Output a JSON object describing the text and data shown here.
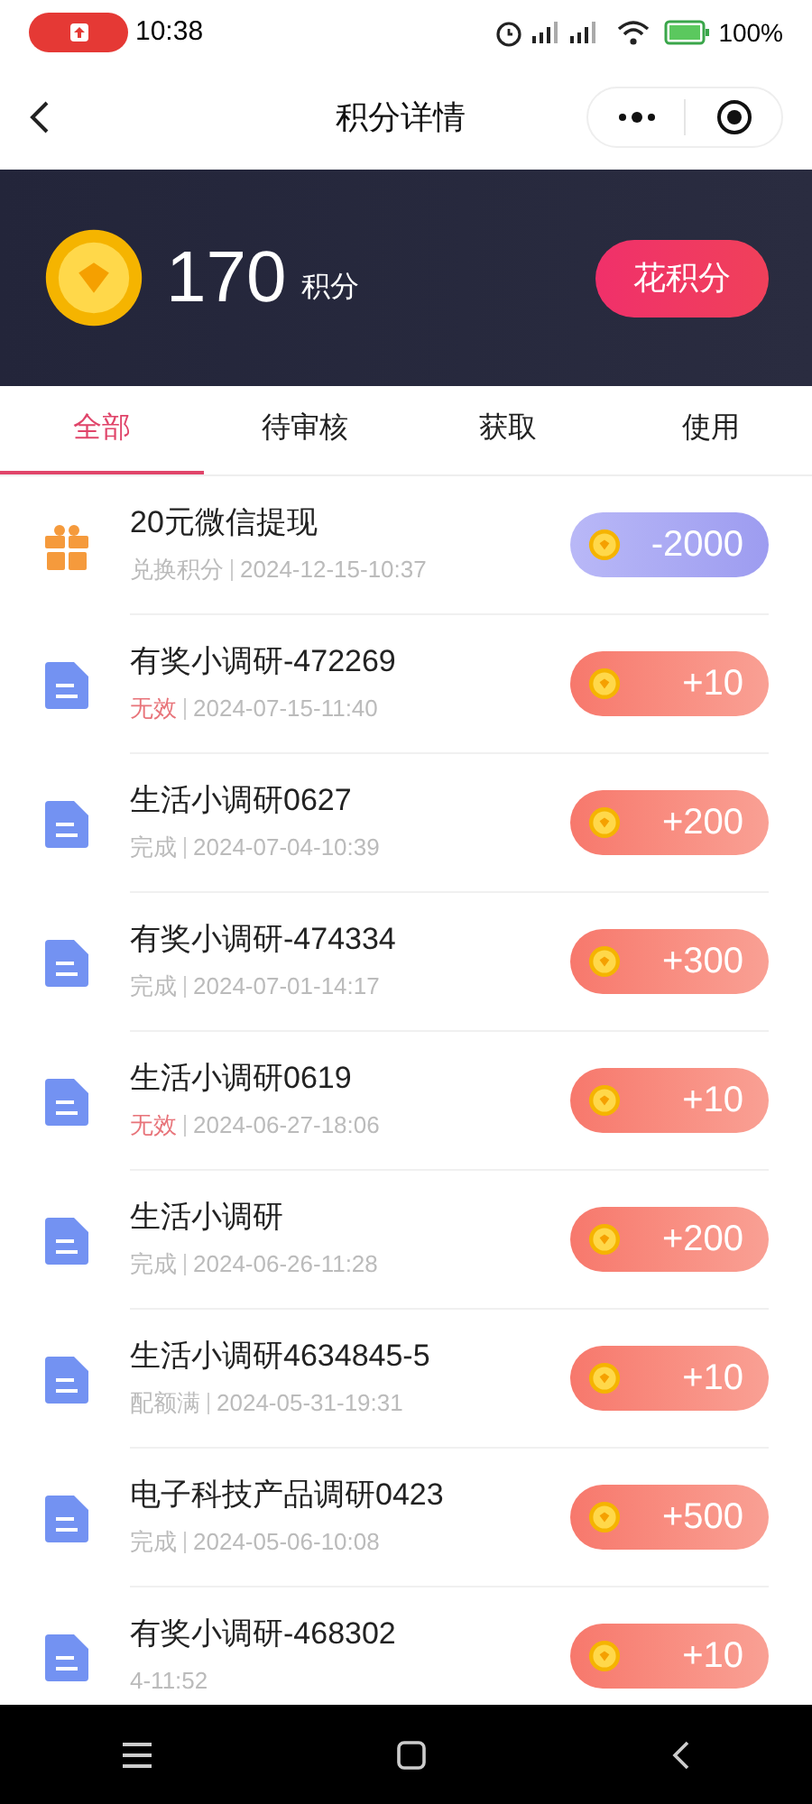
{
  "status_bar": {
    "time": "10:38",
    "battery": "100%"
  },
  "nav": {
    "title": "积分详情"
  },
  "balance": {
    "points": "170",
    "unit": "积分",
    "action": "花积分"
  },
  "tabs": [
    {
      "label": "全部",
      "selected": true
    },
    {
      "label": "待审核",
      "selected": false
    },
    {
      "label": "获取",
      "selected": false
    },
    {
      "label": "使用",
      "selected": false
    }
  ],
  "records": [
    {
      "title": "20元微信提现",
      "status": "兑换积分",
      "invalid": false,
      "time": "2024-12-15-10:37",
      "kind": "spend",
      "amount": "-2000"
    },
    {
      "title": "有奖小调研-472269",
      "status": "无效",
      "invalid": true,
      "time": "2024-07-15-11:40",
      "kind": "earn",
      "amount": "+10"
    },
    {
      "title": "生活小调研0627",
      "status": "完成",
      "invalid": false,
      "time": "2024-07-04-10:39",
      "kind": "earn",
      "amount": "+200"
    },
    {
      "title": "有奖小调研-474334",
      "status": "完成",
      "invalid": false,
      "time": "2024-07-01-14:17",
      "kind": "earn",
      "amount": "+300"
    },
    {
      "title": "生活小调研0619",
      "status": "无效",
      "invalid": true,
      "time": "2024-06-27-18:06",
      "kind": "earn",
      "amount": "+10"
    },
    {
      "title": "生活小调研",
      "status": "完成",
      "invalid": false,
      "time": "2024-06-26-11:28",
      "kind": "earn",
      "amount": "+200"
    },
    {
      "title": "生活小调研4634845-5",
      "status": "配额满",
      "invalid": false,
      "time": "2024-05-31-19:31",
      "kind": "earn",
      "amount": "+10"
    },
    {
      "title": "电子科技产品调研0423",
      "status": "完成",
      "invalid": false,
      "time": "2024-05-06-10:08",
      "kind": "earn",
      "amount": "+500"
    },
    {
      "title": "有奖小调研-468302",
      "time": "4-11:52",
      "kind": "earn",
      "amount": "+10"
    }
  ]
}
